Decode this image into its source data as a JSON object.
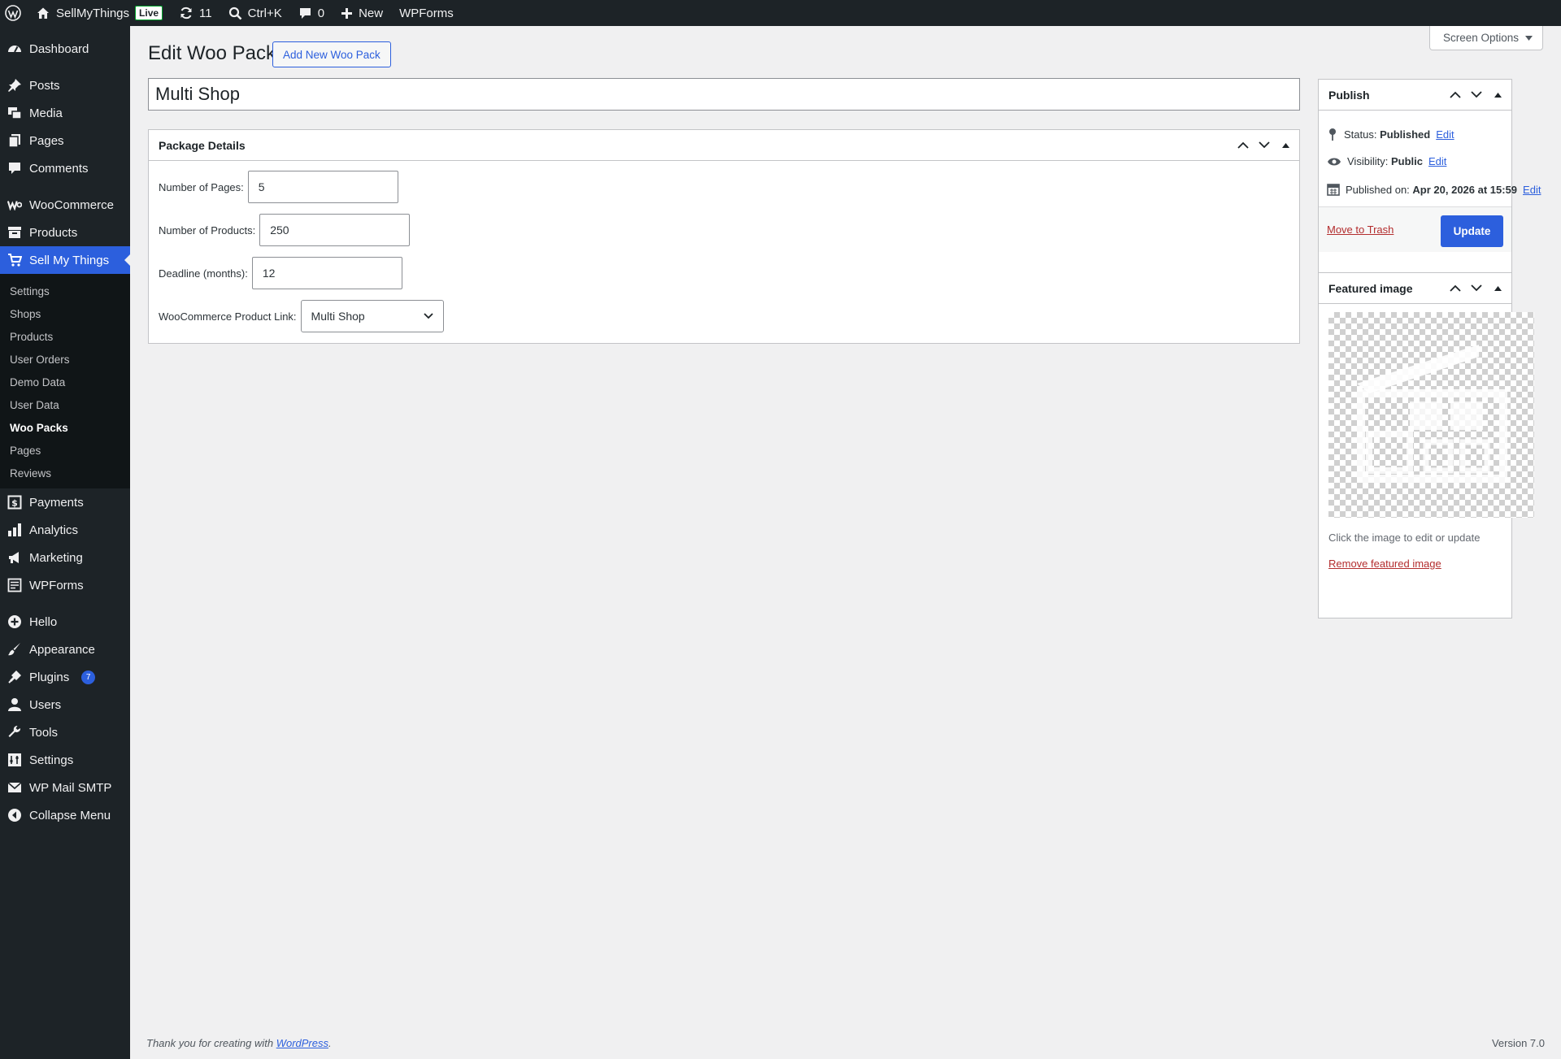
{
  "adminbar": {
    "site_name": "SellMyThings",
    "live_label": "Live",
    "updates_count": "11",
    "search_label": "Ctrl+K",
    "comments_count": "0",
    "new_label": "New",
    "wpforms_label": "WPForms"
  },
  "sidebar": {
    "dashboard": "Dashboard",
    "posts": "Posts",
    "media": "Media",
    "pages": "Pages",
    "comments": "Comments",
    "woocommerce": "WooCommerce",
    "products": "Products",
    "sellmythings": "Sell My Things",
    "submenu": [
      "Settings",
      "Shops",
      "Products",
      "User Orders",
      "Demo Data",
      "User Data",
      "Woo Packs",
      "Pages",
      "Reviews"
    ],
    "payments": "Payments",
    "analytics": "Analytics",
    "marketing": "Marketing",
    "wpforms": "WPForms",
    "hello": "Hello",
    "appearance": "Appearance",
    "plugins": "Plugins",
    "plugins_badge": "7",
    "users": "Users",
    "tools": "Tools",
    "settings": "Settings",
    "wpmailsmtp": "WP Mail SMTP",
    "collapse": "Collapse Menu"
  },
  "header": {
    "screen_options": "Screen Options",
    "title": "Edit Woo Pack",
    "add_new": "Add New Woo Pack"
  },
  "post": {
    "title_value": "Multi Shop"
  },
  "package_details": {
    "heading": "Package Details",
    "pages_label": "Number of Pages:",
    "pages_value": "5",
    "products_label": "Number of Products:",
    "products_value": "250",
    "deadline_label": "Deadline (months):",
    "deadline_value": "12",
    "link_label": "WooCommerce Product Link:",
    "link_value": "Multi Shop"
  },
  "publish": {
    "heading": "Publish",
    "status_label": "Status:",
    "status_value": "Published",
    "visibility_label": "Visibility:",
    "visibility_value": "Public",
    "published_label": "Published on:",
    "published_value": "Apr 20, 2026 at 15:59",
    "edit": "Edit",
    "trash": "Move to Trash",
    "update": "Update"
  },
  "featured": {
    "heading": "Featured image",
    "hint": "Click the image to edit or update",
    "remove": "Remove featured image"
  },
  "footer": {
    "thanks_prefix": "Thank you for creating with",
    "thanks_link": "WordPress",
    "thanks_suffix": ".",
    "version": "Version 7.0"
  },
  "colors": {
    "accent": "#2c5fdd",
    "adminbar_bg": "#1d2327",
    "danger": "#b32d2e"
  }
}
